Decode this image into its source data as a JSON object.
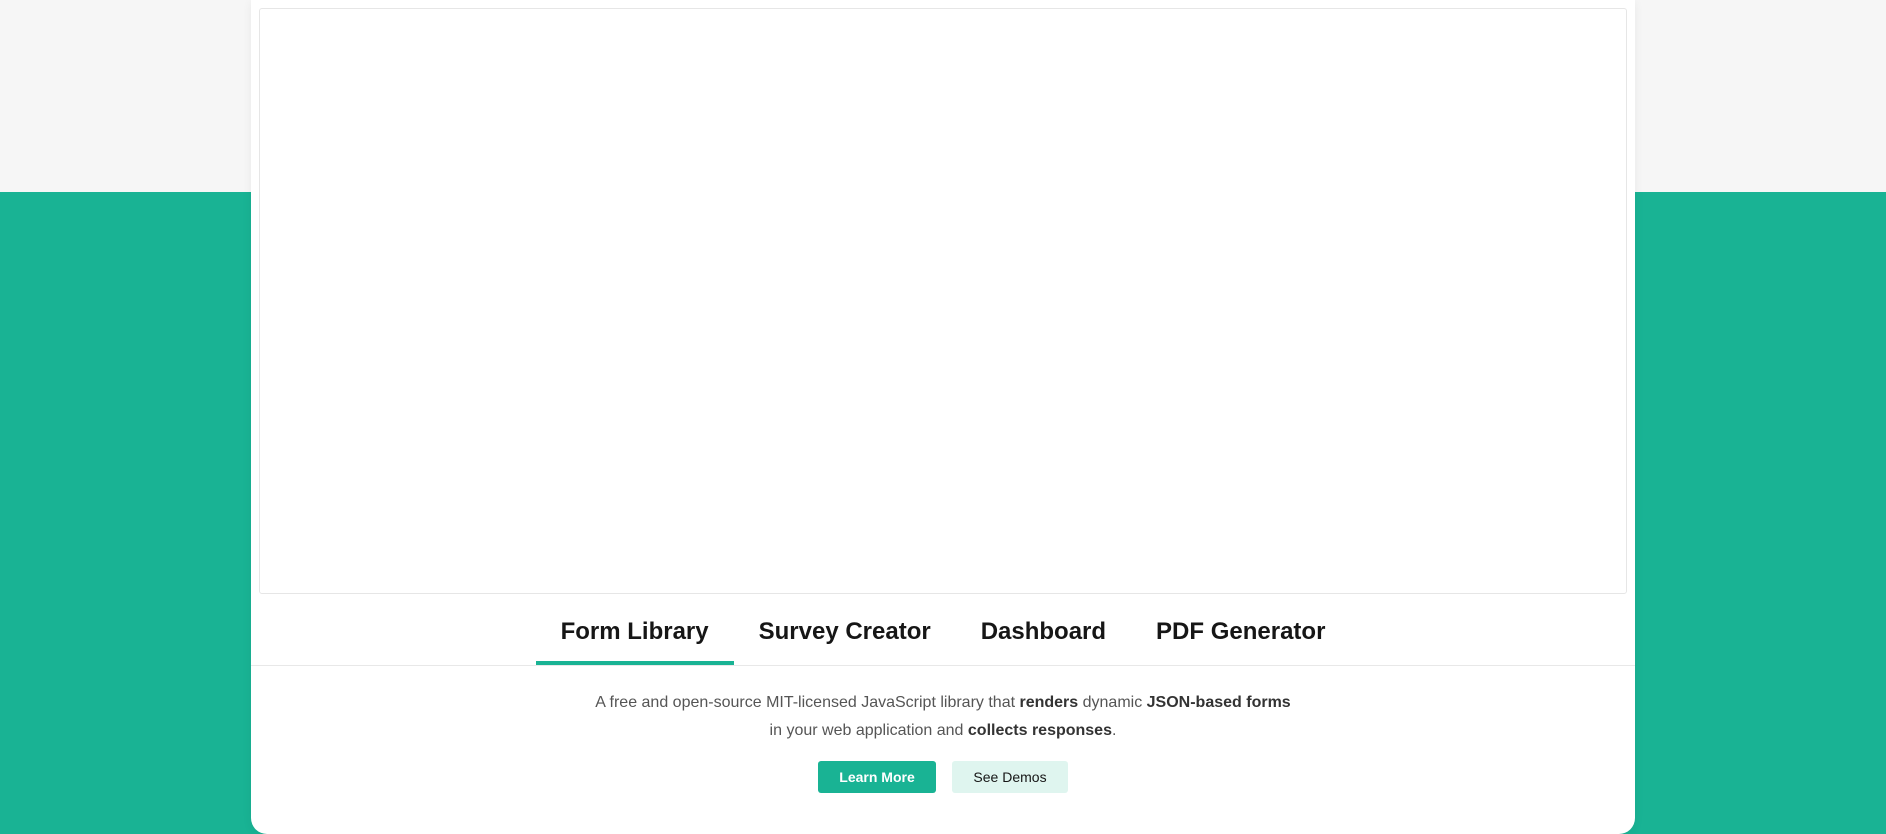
{
  "tabs": [
    {
      "label": "Form Library",
      "active": true
    },
    {
      "label": "Survey Creator",
      "active": false
    },
    {
      "label": "Dashboard",
      "active": false
    },
    {
      "label": "PDF Generator",
      "active": false
    }
  ],
  "description": {
    "p1": "A free and open-source MIT-licensed JavaScript library that ",
    "b1": "renders",
    "p2": " dynamic ",
    "b2": "JSON-based forms",
    "p3": "in your web application and ",
    "b3": "collects responses",
    "p4": "."
  },
  "buttons": {
    "learn_more": "Learn More",
    "see_demos": "See Demos"
  },
  "colors": {
    "accent": "#19b394",
    "accent_light": "#dff5ef",
    "background": "#f6f6f6"
  }
}
